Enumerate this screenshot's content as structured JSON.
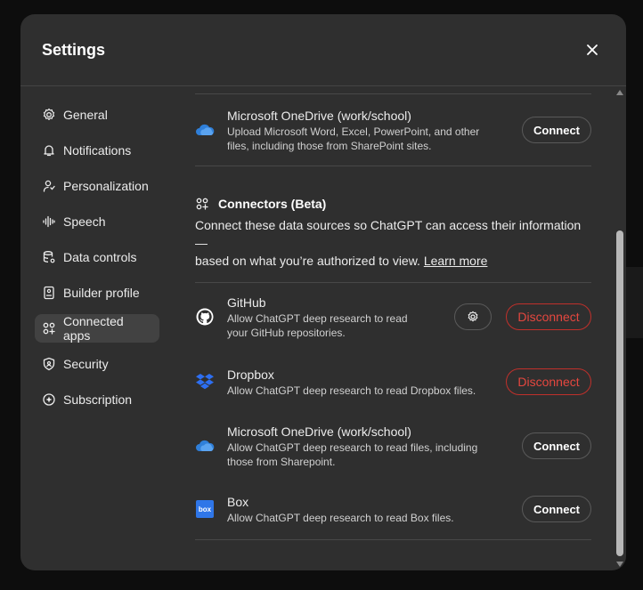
{
  "modal": {
    "title": "Settings"
  },
  "sidebar": {
    "items": [
      {
        "label": "General",
        "icon": "gear-icon"
      },
      {
        "label": "Notifications",
        "icon": "bell-icon"
      },
      {
        "label": "Personalization",
        "icon": "person-icon"
      },
      {
        "label": "Speech",
        "icon": "waveform-icon"
      },
      {
        "label": "Data controls",
        "icon": "database-icon"
      },
      {
        "label": "Builder profile",
        "icon": "id-card-icon"
      },
      {
        "label": "Connected apps",
        "icon": "apps-icon",
        "active": true
      },
      {
        "label": "Security",
        "icon": "shield-icon"
      },
      {
        "label": "Subscription",
        "icon": "circle-icon"
      }
    ]
  },
  "file_uploads": {
    "onedrive": {
      "name": "Microsoft OneDrive (work/school)",
      "desc_line1": "Upload Microsoft Word, Excel, PowerPoint, and other",
      "desc_line2": "files, including those from SharePoint sites.",
      "button": "Connect"
    }
  },
  "connectors": {
    "title": "Connectors (Beta)",
    "desc_line1": "Connect these data sources so ChatGPT can access their information —",
    "desc_line2": "based on what you’re authorized to view.",
    "learn_more": "Learn more",
    "items": [
      {
        "name": "GitHub",
        "desc_line1": "Allow ChatGPT deep research to read",
        "desc_line2": "your GitHub repositories.",
        "button": "Disconnect"
      },
      {
        "name": "Dropbox",
        "desc_line1": "Allow ChatGPT deep research to read Dropbox files.",
        "button": "Disconnect"
      },
      {
        "name": "Microsoft OneDrive (work/school)",
        "desc_line1": "Allow ChatGPT deep research to read files, including",
        "desc_line2": "those from Sharepoint.",
        "button": "Connect"
      },
      {
        "name": "Box",
        "desc_line1": "Allow ChatGPT deep research to read Box files.",
        "button": "Connect",
        "logo_text": "box"
      }
    ]
  },
  "colors": {
    "disconnect": "#e5473f",
    "onedrive": "#2f7fd9",
    "dropbox": "#2d6ff2",
    "box": "#2f76e8"
  }
}
